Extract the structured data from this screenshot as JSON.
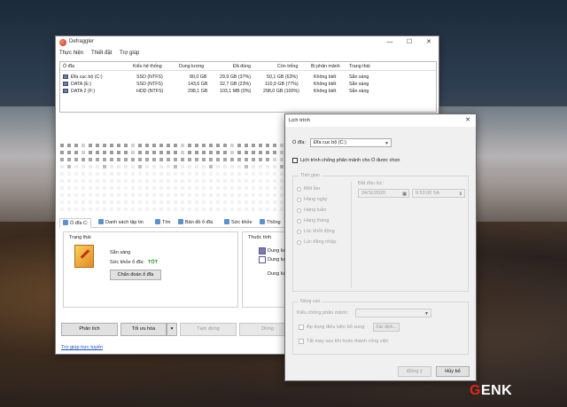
{
  "window": {
    "title": "Defraggler",
    "controls": [
      "—",
      "☐",
      "✕"
    ]
  },
  "menu": [
    "Thực hiện",
    "Thiết đặt",
    "Trợ giúp"
  ],
  "drive_table": {
    "columns": [
      "Ổ đĩa",
      "Kiểu hệ thống",
      "Dung lượng",
      "Đã dùng",
      "Còn trống",
      "Bị phân mảnh",
      "Trạng thái"
    ],
    "rows": [
      [
        "Đĩa cục bộ (C:)",
        "SSD (NTFS)",
        "80,0 GB",
        "29,9 GB (37%)",
        "50,1 GB (63%)",
        "Không biết",
        "Sẵn sàng"
      ],
      [
        "DATA (E:)",
        "SSD (NTFS)",
        "143,6 GB",
        "32,7 GB (23%)",
        "110,9 GB (77%)",
        "Không biết",
        "Sẵn sàng"
      ],
      [
        "DATA 2 (F:)",
        "HDD (NTFS)",
        "298,1 GB",
        "103,1 MB (0%)",
        "298,0 GB (100%)",
        "Không biết",
        "Sẵn sàng"
      ]
    ]
  },
  "tabs": [
    "Ổ đĩa C:",
    "Danh sách tập tin",
    "Tìm",
    "Bản đồ ổ đĩa",
    "Sức khỏe",
    "Thông"
  ],
  "status_panel": {
    "title": "Trạng thái",
    "ready": "Sẵn sàng",
    "health_label": "Sức khỏe ổ đĩa:",
    "health_value": "TỐT",
    "check_button": "Chẩn đoán ổ đĩa",
    "health_color": "#1a9a1a"
  },
  "props_panel": {
    "title": "Thuộc tính",
    "items": [
      "Dung lư",
      "Dung lư",
      "Dung lư"
    ]
  },
  "bottom_buttons": {
    "analyze": "Phân tích",
    "optimize": "Tối ưu hóa",
    "pause": "Tạm dừng",
    "stop": "Dừng"
  },
  "help_link": "Trợ giúp trực tuyến",
  "dialog": {
    "title": "Lịch trình",
    "drive_label": "Ổ đĩa:",
    "drive_value": "Đĩa cục bộ (C:)",
    "schedule_checkbox": "Lịch trình chống phân mảnh cho Ổ được chọn",
    "time_group": "Thời gian",
    "frequency_options": [
      "Một lần",
      "Hàng ngày",
      "Hàng tuần",
      "Hàng tháng",
      "Lúc khởi động",
      "Lúc đăng nhập"
    ],
    "start_label": "Bắt đầu lúc:",
    "start_date": "24/11/2020",
    "start_time": "9:53:00 SA",
    "advanced_group": "Nâng cao",
    "defrag_type_label": "Kiểu chống phân mảnh:",
    "extra_conditions": "Áp dụng điều kiện bổ sung:",
    "extra_button": "Xác định...",
    "shutdown_checkbox": "Tắt máy sau khi hoàn thành công việc",
    "ok_button": "Đồng ý",
    "cancel_button": "Hủy bỏ"
  },
  "watermark": {
    "g": "G",
    "rest": "ENK"
  }
}
